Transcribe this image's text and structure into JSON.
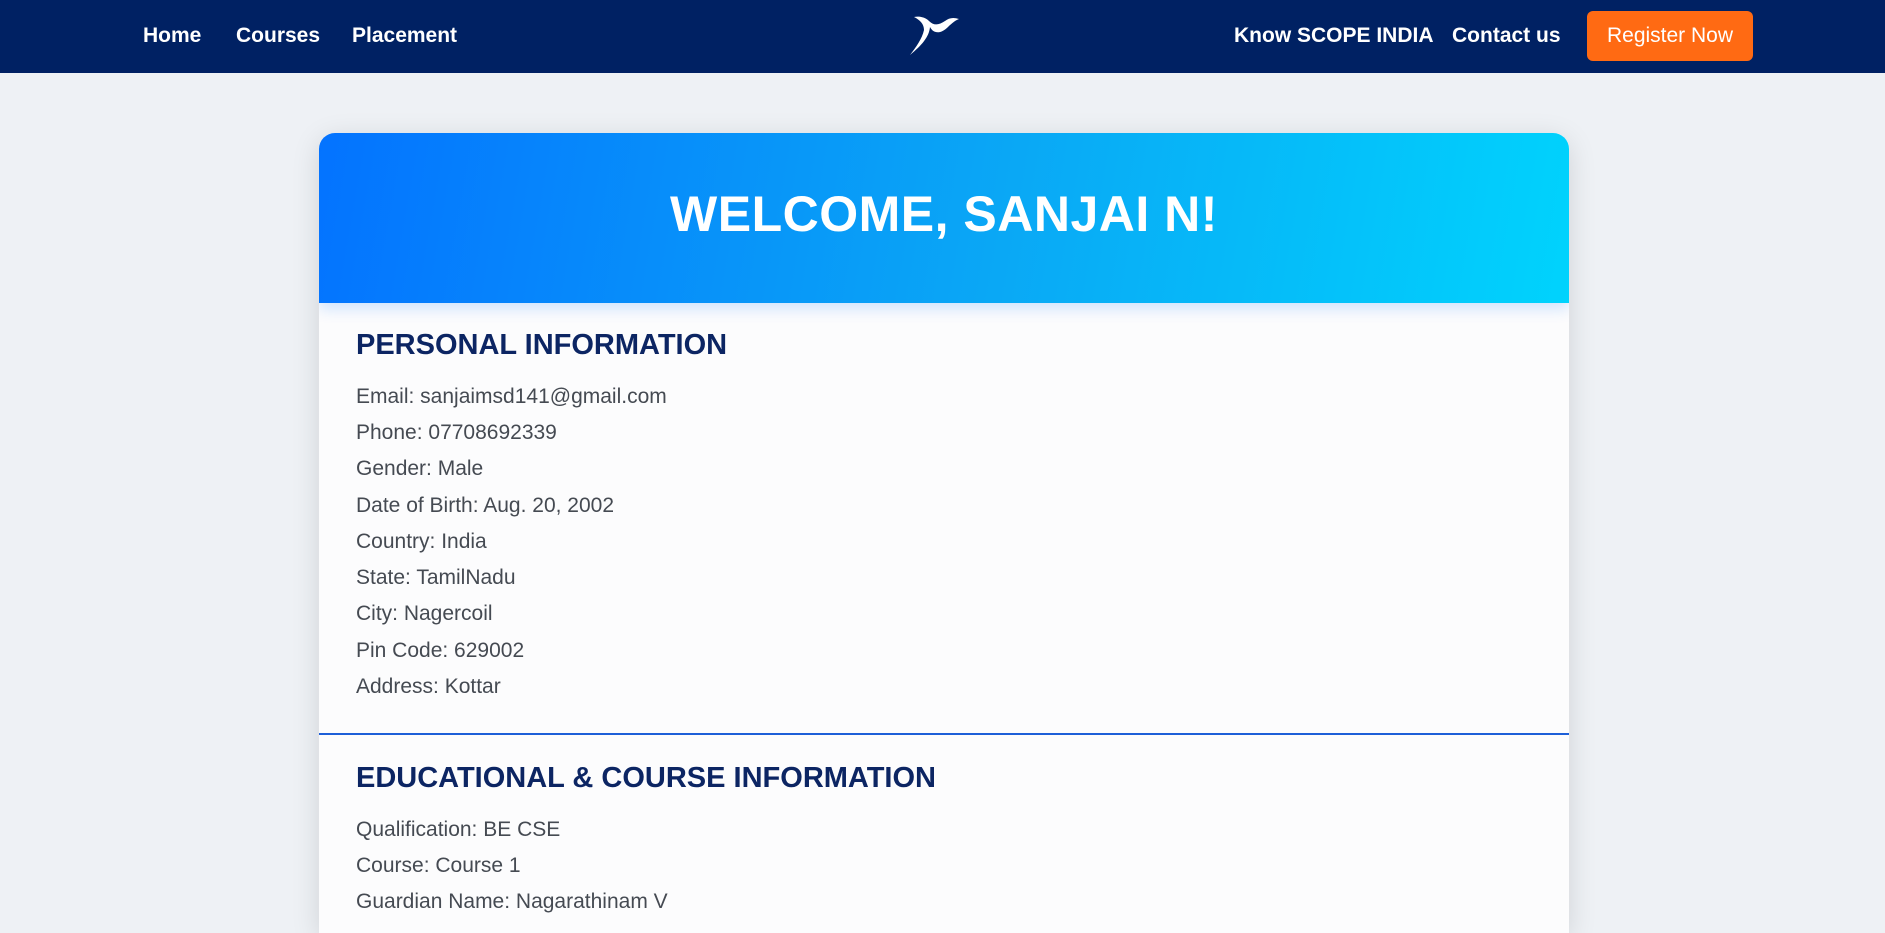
{
  "nav": {
    "home": "Home",
    "courses": "Courses",
    "placement": "Placement",
    "know": "Know SCOPE INDIA",
    "contact": "Contact us",
    "register": "Register Now"
  },
  "colors": {
    "navbar": "#002163",
    "accent": "#ff6a13",
    "header_start": "#0473ff",
    "header_end": "#00d3fd",
    "heading": "#0c2563",
    "divider": "#1d5fd8"
  },
  "icons": {
    "logo": "bird-logo-icon"
  },
  "welcome": "WELCOME, SANJAI N!",
  "personal": {
    "title": "PERSONAL INFORMATION",
    "lines": [
      "Email: sanjaimsd141@gmail.com",
      "Phone: 07708692339",
      "Gender: Male",
      "Date of Birth: Aug. 20, 2002",
      "Country: India",
      "State: TamilNadu",
      "City: Nagercoil",
      "Pin Code: 629002",
      "Address: Kottar"
    ]
  },
  "education": {
    "title": "EDUCATIONAL & COURSE INFORMATION",
    "lines": [
      "Qualification: BE CSE",
      "Course: Course 1",
      "Guardian Name: Nagarathinam V"
    ]
  }
}
